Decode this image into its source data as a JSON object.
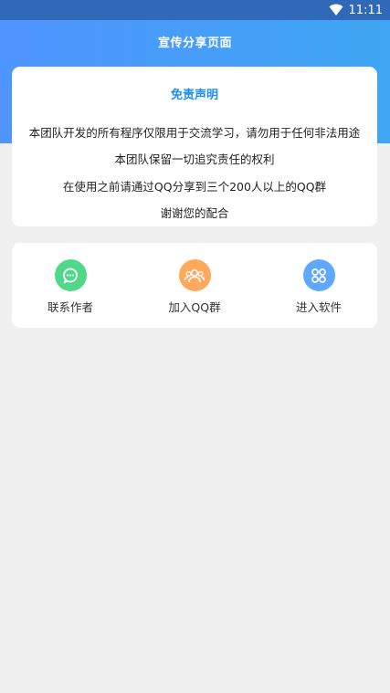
{
  "status_bar": {
    "time": "11:11",
    "wifi_icon": "wifi-icon"
  },
  "header": {
    "title": "宣传分享页面"
  },
  "disclaimer": {
    "title": "免责声明",
    "lines": [
      "本团队开发的所有程序仅限用于交流学习，请勿用于任何非法用途",
      "本团队保留一切追究责任的权利",
      "在使用之前请通过QQ分享到三个200人以上的QQ群",
      "谢谢您的配合"
    ]
  },
  "actions": [
    {
      "label": "联系作者",
      "icon": "chat-bubble-icon",
      "color": "#4fd88a"
    },
    {
      "label": "加入QQ群",
      "icon": "group-people-icon",
      "color": "#ffa95c"
    },
    {
      "label": "进入软件",
      "icon": "apps-grid-icon",
      "color": "#5ea9ff"
    }
  ],
  "colors": {
    "header_gradient_start": "#4f95ff",
    "header_gradient_end": "#3ea6f2",
    "status_bar": "#2f69b8",
    "accent": "#1b8ef0",
    "background": "#f0f0f0"
  }
}
